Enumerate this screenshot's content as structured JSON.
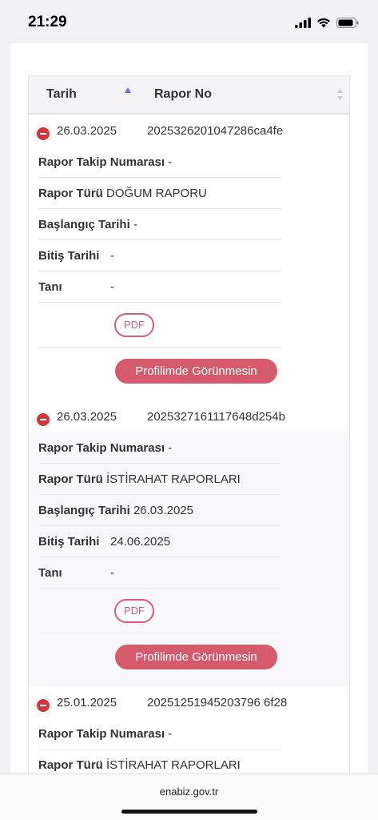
{
  "status_bar": {
    "time": "21:29"
  },
  "table": {
    "columns": [
      {
        "label": "Tarih"
      },
      {
        "label": "Rapor No"
      }
    ]
  },
  "records": [
    {
      "date": "26.03.2025",
      "report_no": "2025326201047286ca4fe",
      "tracking_label": "Rapor Takip Numarası",
      "tracking_value": "-",
      "type_label": "Rapor Türü",
      "type_value": "DOĞUM RAPORU",
      "start_label": "Başlangıç Tarihi",
      "start_value": "-",
      "end_label": "Bitiş Tarihi",
      "end_value": "-",
      "diag_label": "Tanı",
      "diag_value": "-",
      "pdf_label": "PDF",
      "hide_label": "Profilimde Görünmesin"
    },
    {
      "date": "26.03.2025",
      "report_no": "2025327161117648d254b",
      "tracking_label": "Rapor Takip Numarası",
      "tracking_value": "-",
      "type_label": "Rapor Türü",
      "type_value": "İSTİRAHAT RAPORLARI",
      "start_label": "Başlangıç Tarihi",
      "start_value": "26.03.2025",
      "end_label": "Bitiş Tarihi",
      "end_value": "24.06.2025",
      "diag_label": "Tanı",
      "diag_value": "-",
      "pdf_label": "PDF",
      "hide_label": "Profilimde Görünmesin"
    },
    {
      "date": "25.01.2025",
      "report_no": "20251251945203796 6f28",
      "tracking_label": "Rapor Takip Numarası",
      "tracking_value": "-",
      "type_label": "Rapor Türü",
      "type_value": "İSTİRAHAT RAPORLARI"
    }
  ],
  "browser": {
    "url": "enabiz.gov.tr"
  }
}
